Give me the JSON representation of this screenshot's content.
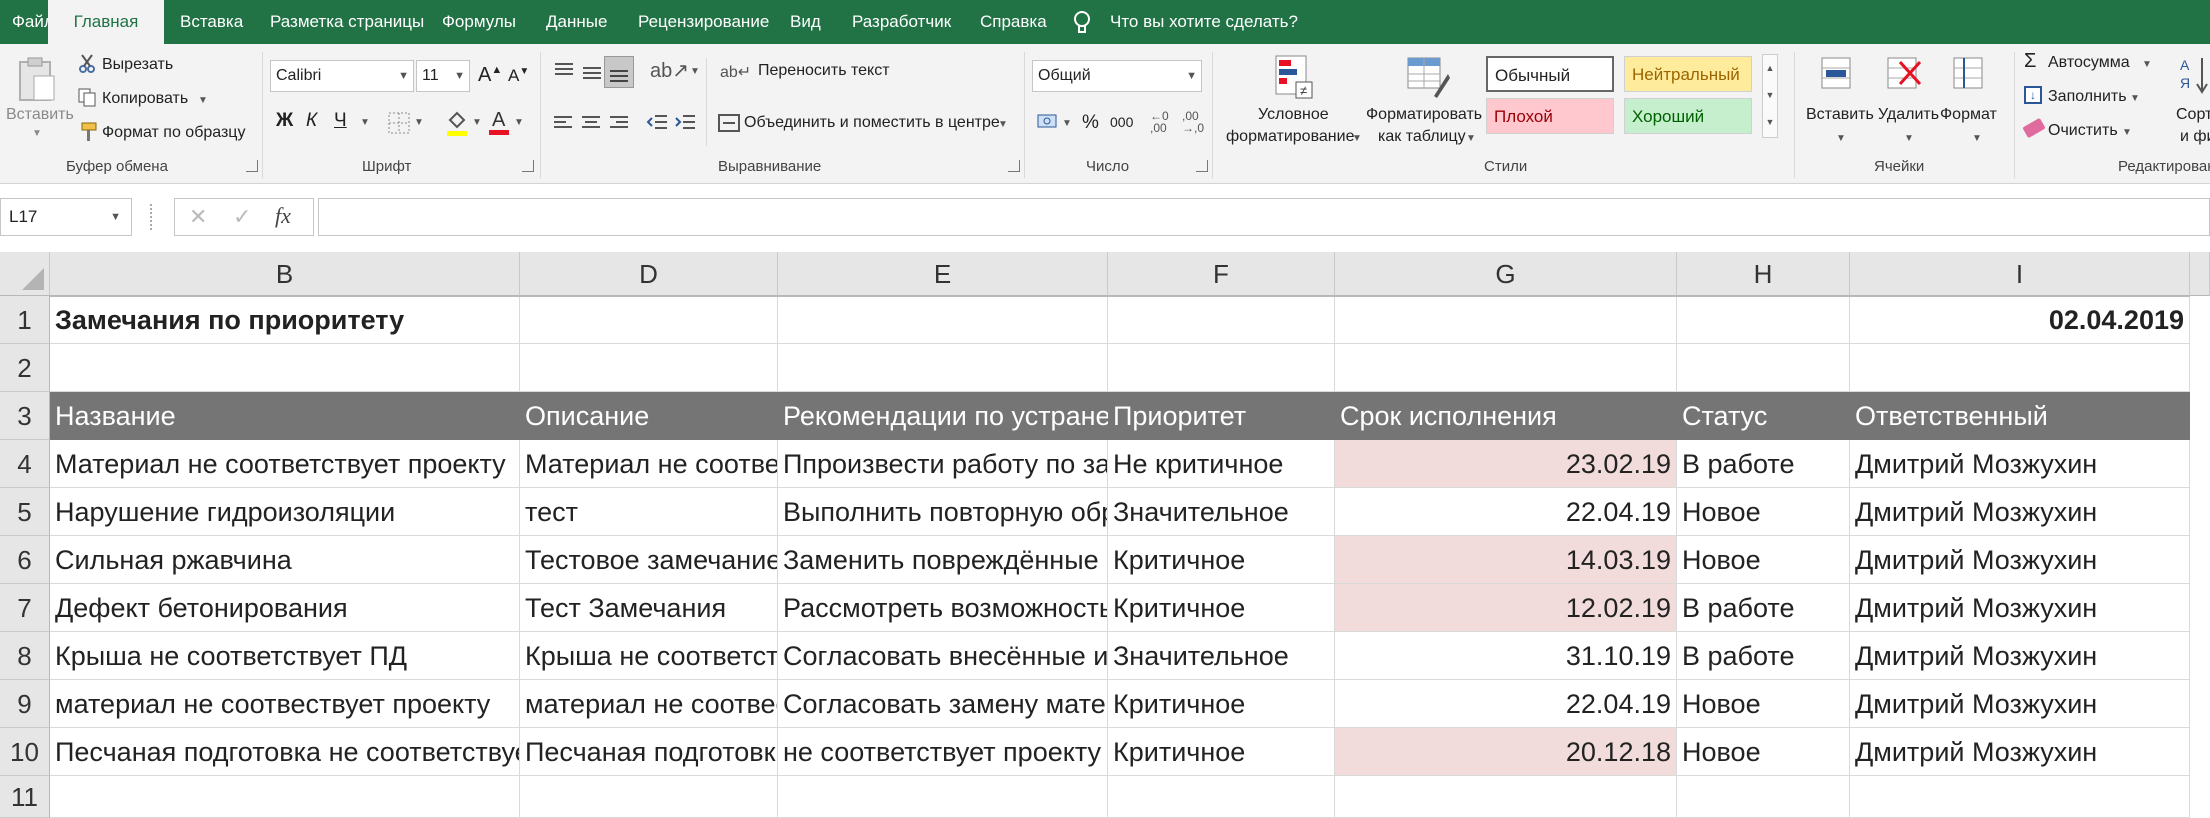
{
  "tabs": [
    {
      "label": "Файл",
      "active": false
    },
    {
      "label": "Главная",
      "active": true
    },
    {
      "label": "Вставка",
      "active": false
    },
    {
      "label": "Разметка страницы",
      "active": false
    },
    {
      "label": "Формулы",
      "active": false
    },
    {
      "label": "Данные",
      "active": false
    },
    {
      "label": "Рецензирование",
      "active": false
    },
    {
      "label": "Вид",
      "active": false
    },
    {
      "label": "Разработчик",
      "active": false
    },
    {
      "label": "Справка",
      "active": false
    }
  ],
  "tell_me": "Что вы хотите сделать?",
  "clipboard": {
    "paste": "Вставить",
    "cut": "Вырезать",
    "copy": "Копировать",
    "format_painter": "Формат по образцу",
    "group": "Буфер обмена"
  },
  "font": {
    "name": "Calibri",
    "size": "11",
    "bold": "Ж",
    "italic": "К",
    "underline": "Ч",
    "group": "Шрифт"
  },
  "alignment": {
    "wrap": "Переносить текст",
    "merge": "Объединить и поместить в центре",
    "group": "Выравнивание"
  },
  "number": {
    "format": "Общий",
    "percent": "%",
    "thousands": "000",
    "group": "Число"
  },
  "styles": {
    "conditional_1": "Условное",
    "conditional_2": "форматирование",
    "as_table_1": "Форматировать",
    "as_table_2": "как таблицу",
    "normal": "Обычный",
    "neutral": "Нейтральный",
    "bad": "Плохой",
    "good": "Хороший",
    "group": "Стили",
    "colors": {
      "neutral_bg": "#ffeb9c",
      "neutral_fg": "#9c6500",
      "bad_bg": "#ffc7ce",
      "bad_fg": "#9c0006",
      "good_bg": "#c6efce",
      "good_fg": "#006100"
    }
  },
  "cells_group": {
    "insert": "Вставить",
    "delete": "Удалить",
    "format": "Формат",
    "group": "Ячейки"
  },
  "editing": {
    "autosum": "Автосумма",
    "fill": "Заполнить",
    "clear": "Очистить",
    "sort_1": "Сортир",
    "sort_2": "и филь",
    "group": "Редактирован"
  },
  "formula_bar": {
    "name_box": "L17",
    "fx": "fx",
    "value": ""
  },
  "columns": [
    "B",
    "D",
    "E",
    "F",
    "G",
    "H",
    "I"
  ],
  "row_numbers": [
    "1",
    "2",
    "3",
    "4",
    "5",
    "6",
    "7",
    "8",
    "9",
    "10",
    "11"
  ],
  "sheet": {
    "title": "Замечания по приоритету",
    "date": "02.04.2019",
    "headers": [
      "Название",
      "Описание",
      "Рекомендации по устранению",
      "Приоритет",
      "Срок исполнения",
      "Статус",
      "Ответственный"
    ],
    "rows": [
      [
        "Материал не соответствует проекту",
        "Материал не соответствует проекту",
        "Ппроизвести работу по замене",
        "Не критичное",
        "23.02.19",
        "В работе",
        "Дмитрий Мозжухин"
      ],
      [
        "Нарушение гидроизоляции",
        "тест",
        "Выполнить повторную обработку",
        "Значительное",
        "22.04.19",
        "Новое",
        "Дмитрий Мозжухин"
      ],
      [
        "Сильная ржавчина",
        "Тестовое замечание",
        "Заменить повреждённые элементы",
        "Критичное",
        "14.03.19",
        "Новое",
        "Дмитрий Мозжухин"
      ],
      [
        "Дефект бетонирования",
        "Тест Замечания",
        "Рассмотреть возможность",
        "Критичное",
        "12.02.19",
        "В работе",
        "Дмитрий Мозжухин"
      ],
      [
        "Крыша не соответствует ПД",
        "Крыша не соответствует ПД",
        "Согласовать внесённые изменения",
        "Значительное",
        "31.10.19",
        "В работе",
        "Дмитрий Мозжухин"
      ],
      [
        "материал не соотвествует проекту",
        "материал не соотвествует проекту",
        "Согласовать замену материала",
        "Критичное",
        "22.04.19",
        "Новое",
        "Дмитрий Мозжухин"
      ],
      [
        "Песчаная подготовка не соответствует проекту",
        "Песчаная подготовка не соответствует проекту",
        "не соответствует проекту",
        "Критичное",
        "20.12.18",
        "Новое",
        "Дмитрий Мозжухин"
      ]
    ],
    "overdue": [
      true,
      false,
      true,
      true,
      false,
      false,
      true
    ],
    "colors": {
      "header_bg": "#757575",
      "overdue_bg": "#f2dcdb",
      "accent": "#217346"
    }
  }
}
